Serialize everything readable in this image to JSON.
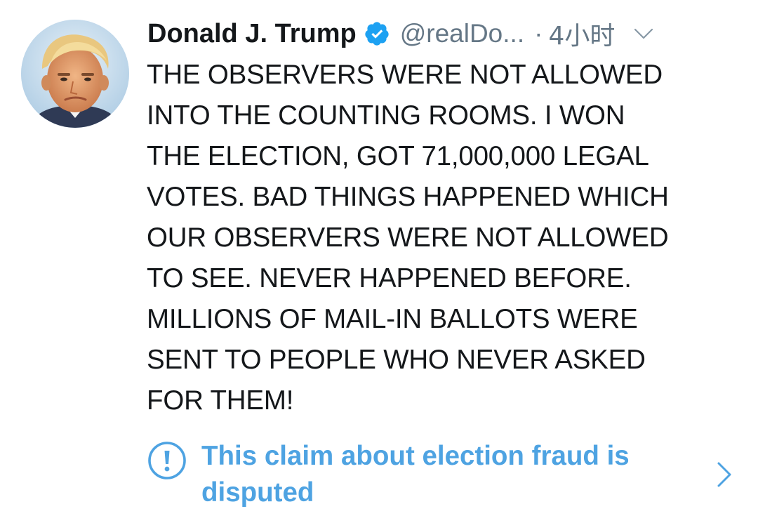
{
  "tweet": {
    "author": {
      "display_name": "Donald J. Trump",
      "handle": "@realDo...",
      "verified": true,
      "avatar": "profile-photo"
    },
    "separator": "·",
    "timestamp": "4小时",
    "text": "THE OBSERVERS WERE NOT ALLOWED\nINTO THE COUNTING ROOMS. I WON\nTHE ELECTION, GOT 71,000,000 LEGAL\nVOTES. BAD THINGS HAPPENED WHICH\nOUR OBSERVERS WERE NOT ALLOWED\nTO SEE. NEVER HAPPENED BEFORE.\nMILLIONS OF MAIL-IN BALLOTS WERE\nSENT TO PEOPLE WHO NEVER ASKED\nFOR THEM!",
    "notice": {
      "text": "This claim about election fraud is disputed",
      "icon": "exclamation-circle-icon",
      "chevron": "chevron-right-icon"
    }
  },
  "colors": {
    "text": "#14171a",
    "muted": "#657786",
    "accent": "#1da1f2",
    "notice": "#4ea3e2"
  }
}
